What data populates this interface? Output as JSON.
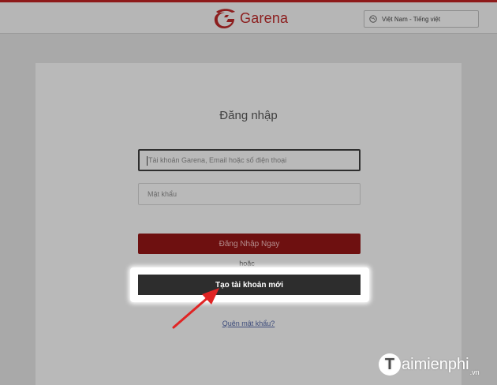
{
  "header": {
    "brand": "Garena",
    "brand_color": "#8c1e1e",
    "brand_icon": "garena-logo-icon",
    "language": "Việt Nam - Tiếng việt",
    "language_icon": "globe-icon"
  },
  "form": {
    "title": "Đăng nhập",
    "account": {
      "value": "",
      "placeholder": "Tài khoản Garena, Email hoặc số điện thoại"
    },
    "password": {
      "value": "",
      "placeholder": "Mật khẩu"
    },
    "login_label": "Đăng Nhập Ngay",
    "login_color": "#6e1010",
    "or_label": "hoặc",
    "create_label": "Tạo tài khoản mới",
    "forgot_label": "Quên mật khẩu?"
  },
  "annotation": {
    "arrow_icon": "red-arrow-icon",
    "arrow_color": "#e02424"
  },
  "watermark": {
    "logo_letter": "T",
    "text": "aimienphi",
    "suffix": ".vn"
  }
}
